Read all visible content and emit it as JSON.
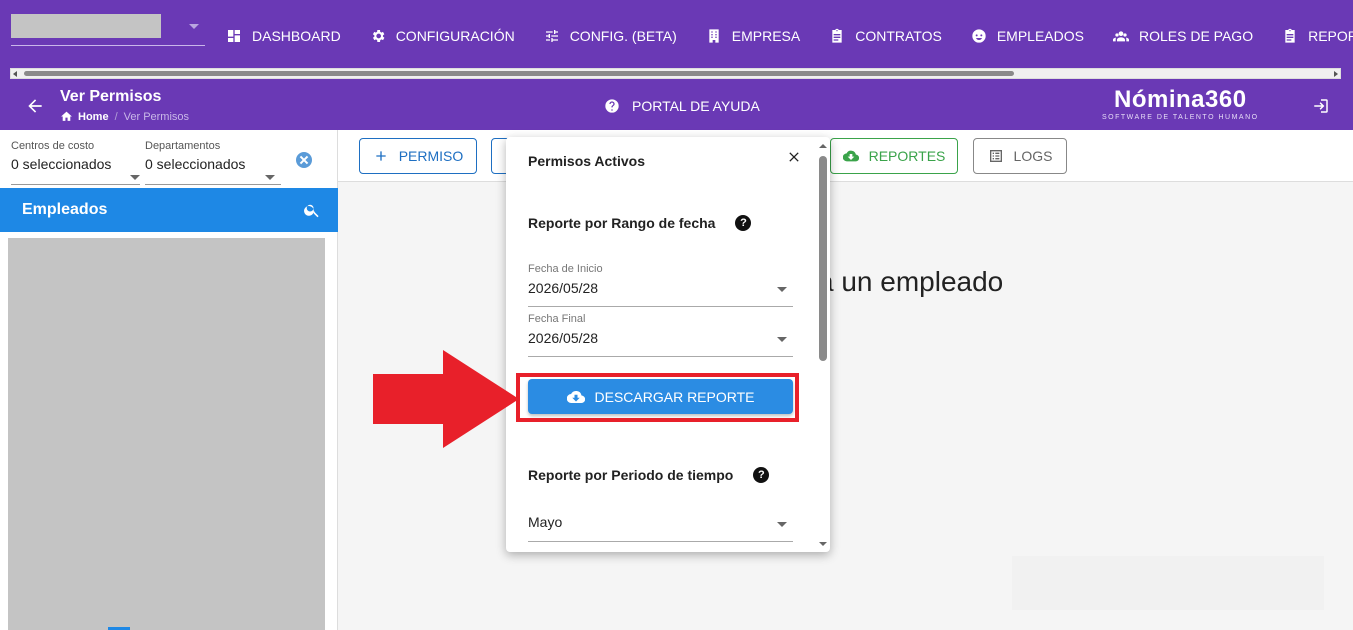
{
  "nav": {
    "items": [
      {
        "label": "DASHBOARD",
        "icon": "dashboard-icon"
      },
      {
        "label": "CONFIGURACIÓN",
        "icon": "gear-icon"
      },
      {
        "label": "CONFIG. (BETA)",
        "icon": "sliders-icon"
      },
      {
        "label": "EMPRESA",
        "icon": "building-icon"
      },
      {
        "label": "CONTRATOS",
        "icon": "clipboard-icon"
      },
      {
        "label": "EMPLEADOS",
        "icon": "face-icon"
      },
      {
        "label": "ROLES DE PAGO",
        "icon": "group-icon"
      },
      {
        "label": "REPORTES",
        "icon": "clipboard-icon"
      }
    ]
  },
  "header": {
    "title": "Ver Permisos",
    "breadcrumb_home": "Home",
    "breadcrumb_current": "Ver Permisos",
    "help_label": "PORTAL DE AYUDA",
    "brand_name": "Nómina360",
    "brand_tagline": "SOFTWARE DE TALENTO HUMANO"
  },
  "filters": {
    "cost_centers_label": "Centros de costo",
    "cost_centers_value": "0 seleccionados",
    "departments_label": "Departamentos",
    "departments_value": "0 seleccionados"
  },
  "employees": {
    "title": "Empleados"
  },
  "toolbar": {
    "permiso_label": "PERMISO",
    "reportes_label": "REPORTES",
    "logs_label": "LOGS"
  },
  "main": {
    "message": "a un empleado"
  },
  "dialog": {
    "title": "Permisos Activos",
    "section_range_title": "Reporte por Rango de fecha",
    "start_label": "Fecha de Inicio",
    "start_value": "2026/05/28",
    "end_label": "Fecha Final",
    "end_value": "2026/05/28",
    "download_label": "DESCARGAR REPORTE",
    "section_period_title": "Reporte por Periodo de tiempo",
    "period_value": "Mayo"
  },
  "colors": {
    "header_purple": "#6a39b5",
    "primary_blue": "#1e88e5",
    "success_green": "#3aa34a",
    "annotation_red": "#e8202a"
  }
}
